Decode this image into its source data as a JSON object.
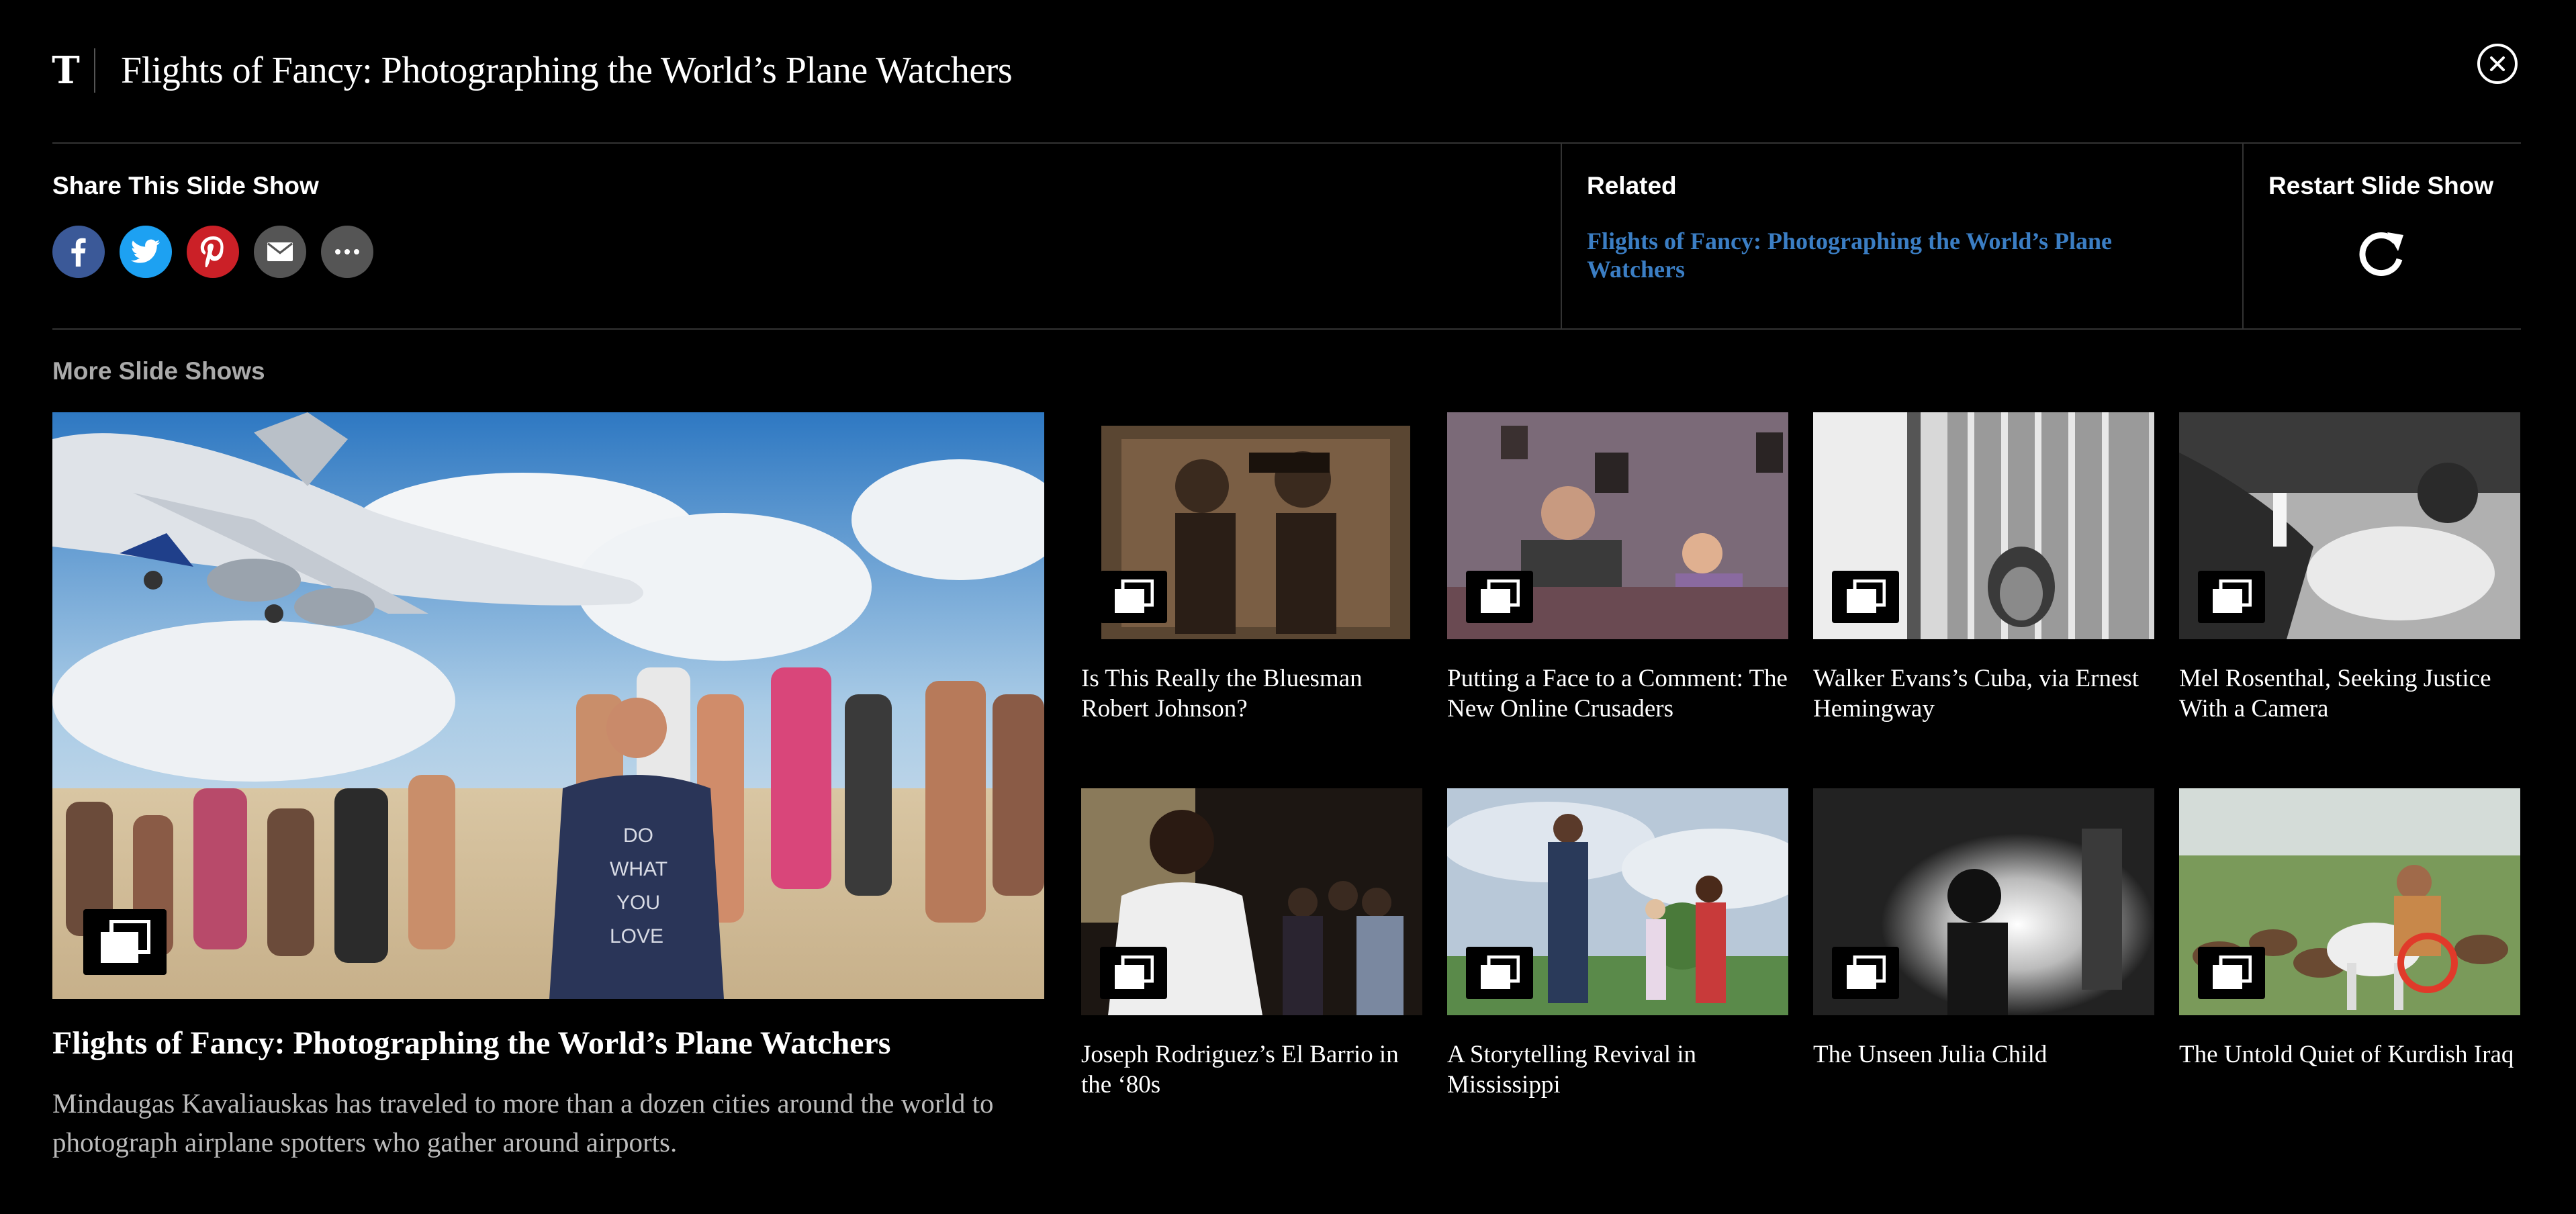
{
  "header": {
    "title": "Flights of Fancy: Photographing the World’s Plane Watchers",
    "logo": "T",
    "close_icon": "close-icon"
  },
  "share": {
    "label": "Share This Slide Show",
    "icons": [
      {
        "name": "facebook-icon",
        "glyph": "f",
        "color": "#3b5998"
      },
      {
        "name": "twitter-icon",
        "glyph": "t",
        "color": "#1da1f2"
      },
      {
        "name": "pinterest-icon",
        "glyph": "P",
        "color": "#cb2027"
      },
      {
        "name": "email-icon",
        "glyph": "✉",
        "color": "#555555"
      },
      {
        "name": "more-icon",
        "glyph": "•••",
        "color": "#555555"
      }
    ]
  },
  "related": {
    "label": "Related",
    "link": "Flights of Fancy: Photographing the World’s Plane Watchers",
    "link_color": "#3b7ec4"
  },
  "restart": {
    "label": "Restart Slide Show"
  },
  "more": {
    "label": "More Slide Shows",
    "featured": {
      "title": "Flights of Fancy: Photographing the World’s Plane Watchers",
      "description": "Mindaugas Kavaliauskas has traveled to more than a dozen cities around the world to photograph airplane spotters who gather around airports."
    },
    "tiles": [
      {
        "caption": "Is This Really the Bluesman Robert Johnson?"
      },
      {
        "caption": "Putting a Face to a Comment: The New Online Crusaders"
      },
      {
        "caption": "Walker Evans’s Cuba, via Ernest Hemingway"
      },
      {
        "caption": "Mel Rosenthal, Seeking Justice With a Camera"
      },
      {
        "caption": "Joseph Rodriguez’s El Barrio in the ‘80s"
      },
      {
        "caption": "A Storytelling Revival in Mississippi"
      },
      {
        "caption": "The Unseen Julia Child"
      },
      {
        "caption": "The Untold Quiet of Kurdish Iraq"
      }
    ]
  }
}
